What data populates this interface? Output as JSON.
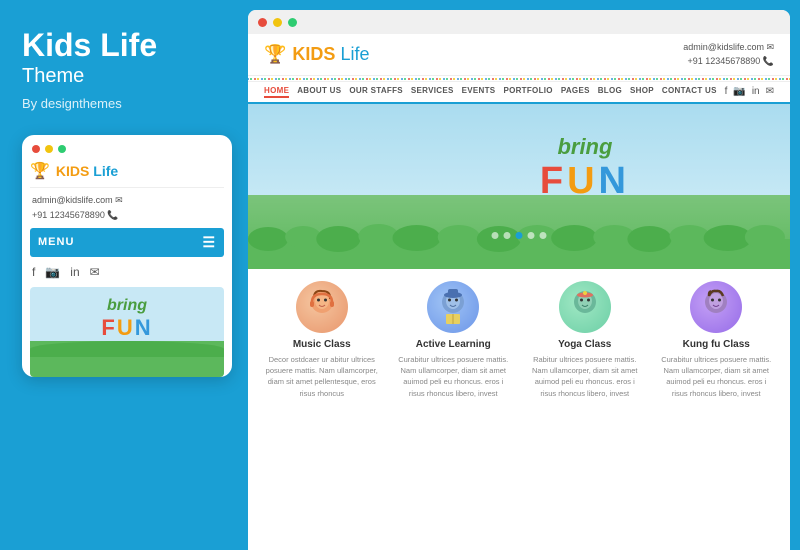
{
  "left": {
    "title": "Kids Life",
    "subtitle": "Theme",
    "by": "By designthemes"
  },
  "mobile": {
    "logo_trophy": "🏆",
    "logo_text_kids": "KIDS",
    "logo_text_life": "Life",
    "contact_email": "admin@kidslife.com",
    "contact_phone": "+91 12345678890",
    "nav_label": "MENU",
    "hero_bring": "bring",
    "hero_fun_letters": [
      "F",
      "U",
      "N"
    ]
  },
  "desktop": {
    "titlebar_dots": [
      "red",
      "yellow",
      "green"
    ],
    "site": {
      "logo_trophy": "🏆",
      "logo_kids": "KIDS",
      "logo_life": "Life",
      "contact_email": "admin@kidslife.com ✉",
      "contact_phone": "+91 12345678890 📞",
      "nav_items": [
        "HOME",
        "ABOUT US",
        "OUR STAFFS",
        "SERVICES",
        "EVENTS",
        "PORTFOLIO",
        "PAGES",
        "BLOG",
        "SHOP",
        "CONTACT US"
      ],
      "social_icons": [
        "f",
        "📷",
        "in",
        "✉"
      ],
      "hero_bring": "bring",
      "hero_fun_letters": [
        "F",
        "U",
        "N"
      ],
      "hero_dots": [
        false,
        false,
        true,
        false,
        false
      ],
      "classes": [
        {
          "name": "Music Class",
          "emoji": "🎵",
          "desc": "Decor ostdcaer ur abitur ultrices posuere mattis. Nam ullamcorper, diam sit amet pellentesque, eros risus rhoncus"
        },
        {
          "name": "Active Learning",
          "emoji": "📚",
          "desc": "Curabitur ultrices posuere mattis. Nam ullamcorper, diam sit amet auimod peli eu rhoncus. eros i risus rhoncus libero, invest"
        },
        {
          "name": "Yoga Class",
          "emoji": "🧘",
          "desc": "Rabitur ultrices posuere mattis. Nam ullamcorper, diam sit amet auimod peli eu rhoncus. eros i risus rhoncus libero, invest"
        },
        {
          "name": "Kung Fu Class",
          "emoji": "🥋",
          "desc": "Curabitur ultrices posuere mattis. Nam ullamcorper, diam sit amet auimod peli eu rhoncus. eros i risus rhoncus libero, invest"
        }
      ]
    }
  }
}
